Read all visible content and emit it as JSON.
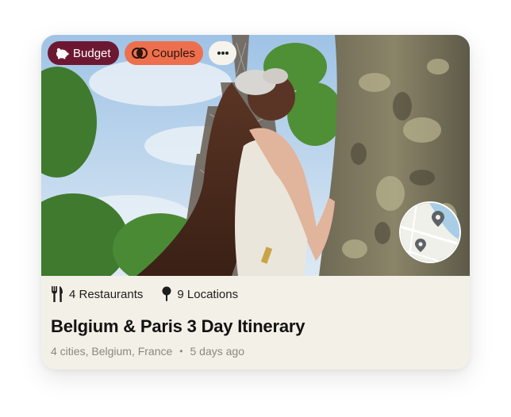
{
  "tags": {
    "budget_label": "Budget",
    "couples_label": "Couples",
    "budget_icon": "piggy-bank-icon",
    "couples_icon": "linked-rings-icon",
    "more_icon": "ellipsis-icon"
  },
  "photo": {
    "subject": "woman-by-tree-eiffel-tower",
    "map_icon": "map-pin-icon"
  },
  "stats": {
    "restaurants": "4 Restaurants",
    "locations": "9 Locations",
    "restaurant_icon": "fork-knife-icon",
    "location_icon": "pin-icon"
  },
  "itinerary": {
    "title": "Belgium & Paris 3 Day Itinerary",
    "places": "4 cities, Belgium, France",
    "separator": "•",
    "posted": "5 days ago"
  },
  "colors": {
    "budget_chip": "#6d1833",
    "couples_chip": "#ee6f4d",
    "card_footer": "#f3f0e7"
  }
}
